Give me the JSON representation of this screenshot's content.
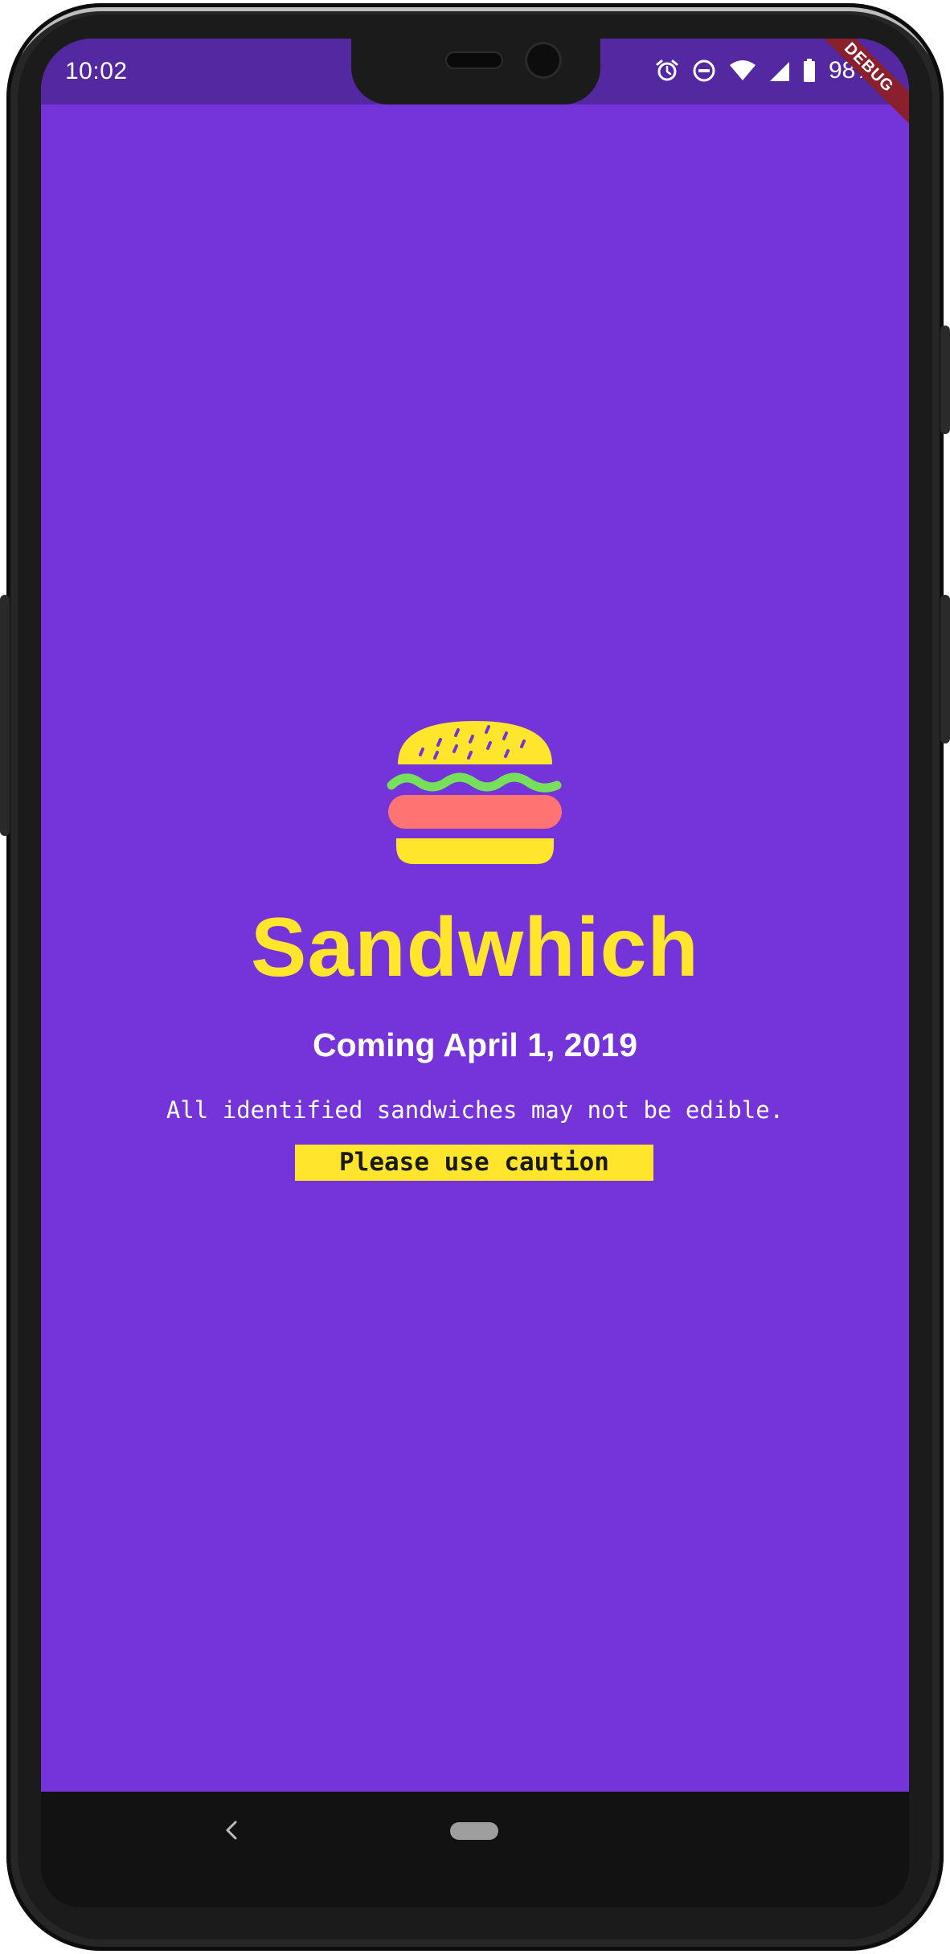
{
  "status_bar": {
    "time": "10:02",
    "battery_percent": "98%",
    "icons": [
      "alarm-icon",
      "do-not-disturb-icon",
      "wifi-icon",
      "cell-signal-icon",
      "battery-icon"
    ]
  },
  "debug_banner": "DEBUG",
  "app": {
    "title": "Sandwhich",
    "coming": "Coming April 1, 2019",
    "disclaimer": "All identified sandwiches may not be edible.",
    "caution": "Please use caution",
    "logo": "burger-icon"
  },
  "navigation": {
    "back": "back-icon",
    "home": "home-pill"
  },
  "colors": {
    "background": "#7434d9",
    "status_bar": "#5328a0",
    "accent_yellow": "#ffe52b",
    "lettuce_green": "#76e05a",
    "patty_red": "#ff7373",
    "debug_red": "#8a1f2e"
  }
}
